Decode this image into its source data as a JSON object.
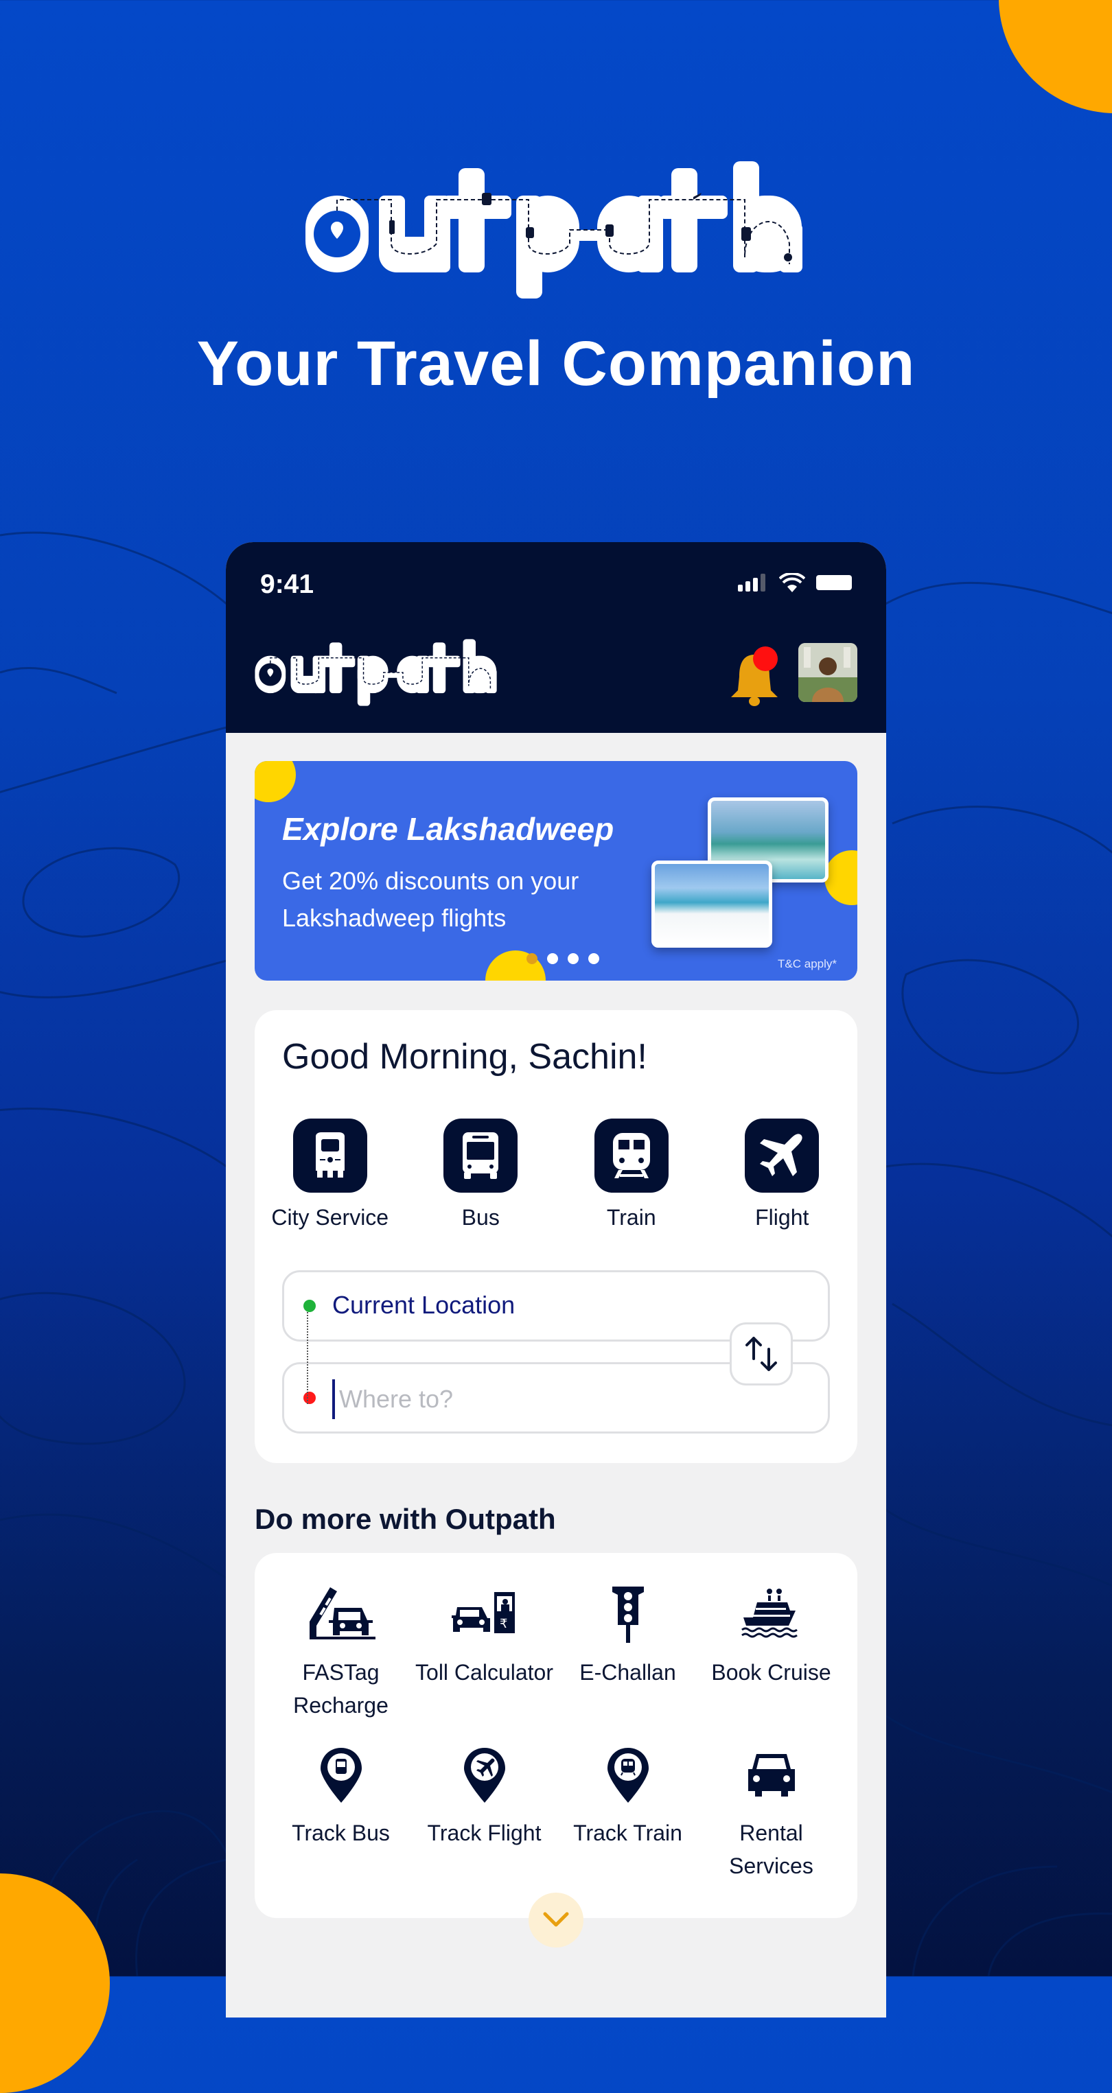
{
  "hero": {
    "brand": "outpath",
    "tagline": "Your Travel Companion"
  },
  "status_bar": {
    "time": "9:41",
    "icons": [
      "signal-icon",
      "wifi-icon",
      "battery-icon"
    ]
  },
  "app_bar": {
    "brand": "outpath",
    "notification_icon": "bell-icon",
    "has_unread_notifications": true,
    "avatar": "user-avatar"
  },
  "banner": {
    "title": "Explore Lakshadweep",
    "subtitle": "Get 20% discounts on your Lakshadweep flights",
    "terms": "T&C apply*",
    "slides_total": 4,
    "active_slide": 1
  },
  "greeting_card": {
    "greeting": "Good Morning, Sachin!",
    "modes": [
      {
        "label": "City Service",
        "icon": "auto-rickshaw-icon"
      },
      {
        "label": "Bus",
        "icon": "bus-icon"
      },
      {
        "label": "Train",
        "icon": "train-icon"
      },
      {
        "label": "Flight",
        "icon": "airplane-icon"
      }
    ],
    "from": {
      "value": "Current Location",
      "dot_color": "#1fb23a"
    },
    "to": {
      "value": "",
      "placeholder": "Where to?",
      "dot_color": "#ff1a1a"
    },
    "swap_icon": "swap-vertical-icon"
  },
  "more": {
    "title": "Do more with Outpath",
    "services": [
      {
        "label": "FASTag Recharge",
        "icon": "toll-barrier-car-icon"
      },
      {
        "label": "Toll Calculator",
        "icon": "toll-booth-icon"
      },
      {
        "label": "E-Challan",
        "icon": "traffic-light-icon"
      },
      {
        "label": "Book Cruise",
        "icon": "cruise-ship-icon"
      },
      {
        "label": "Track Bus",
        "icon": "bus-location-pin-icon"
      },
      {
        "label": "Track Flight",
        "icon": "flight-location-pin-icon"
      },
      {
        "label": "Track Train",
        "icon": "train-location-pin-icon"
      },
      {
        "label": "Rental Services",
        "icon": "car-icon"
      }
    ],
    "expand_icon": "chevron-down-icon"
  },
  "colors": {
    "background_top": "#0448c8",
    "background_bottom": "#031240",
    "accent_orange": "#ffa800",
    "app_bar": "#020f32",
    "banner_blue": "#3a69e6",
    "banner_yellow": "#ffd600",
    "text_dark": "#0c1633",
    "location_text": "#101a7c"
  }
}
